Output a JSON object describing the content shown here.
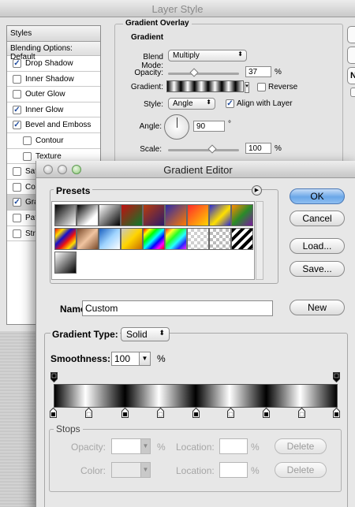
{
  "layer_style": {
    "title": "Layer Style",
    "styles_header": "Styles",
    "blending_options": "Blending Options: Default",
    "items": [
      {
        "label": "Drop Shadow",
        "checked": true
      },
      {
        "label": "Inner Shadow",
        "checked": false
      },
      {
        "label": "Outer Glow",
        "checked": false
      },
      {
        "label": "Inner Glow",
        "checked": true
      },
      {
        "label": "Bevel and Emboss",
        "checked": true
      },
      {
        "label": "Contour",
        "checked": false
      },
      {
        "label": "Texture",
        "checked": false
      },
      {
        "label": "Sati",
        "checked": false
      },
      {
        "label": "Colo",
        "checked": false
      },
      {
        "label": "Grad",
        "checked": true
      },
      {
        "label": "Patte",
        "checked": false
      },
      {
        "label": "Strol",
        "checked": false
      }
    ],
    "gradient_overlay": {
      "section_title": "Gradient Overlay",
      "subsection_title": "Gradient",
      "blend_mode_label": "Blend Mode:",
      "blend_mode_value": "Multiply",
      "opacity_label": "Opacity:",
      "opacity_value": "37",
      "opacity_unit": "%",
      "gradient_label": "Gradient:",
      "reverse_label": "Reverse",
      "style_label": "Style:",
      "style_value": "Angle",
      "align_label": "Align with Layer",
      "angle_label": "Angle:",
      "angle_value": "90",
      "angle_unit": "°",
      "scale_label": "Scale:",
      "scale_value": "100",
      "scale_unit": "%"
    },
    "right_button_partial": "N"
  },
  "gradient_editor": {
    "title": "Gradient Editor",
    "presets_label": "Presets",
    "presets_menu_icon": "play-arrow-icon",
    "buttons": {
      "ok": "OK",
      "cancel": "Cancel",
      "load": "Load...",
      "save": "Save...",
      "new": "New"
    },
    "name_label": "Name:",
    "name_value": "Custom",
    "gradient_type_label": "Gradient Type:",
    "gradient_type_value": "Solid",
    "smoothness_label": "Smoothness:",
    "smoothness_value": "100",
    "smoothness_unit": "%",
    "stops": {
      "title": "Stops",
      "opacity_label": "Opacity:",
      "opacity_unit": "%",
      "location_label": "Location:",
      "location_unit": "%",
      "color_label": "Color:",
      "delete_label": "Delete"
    }
  }
}
